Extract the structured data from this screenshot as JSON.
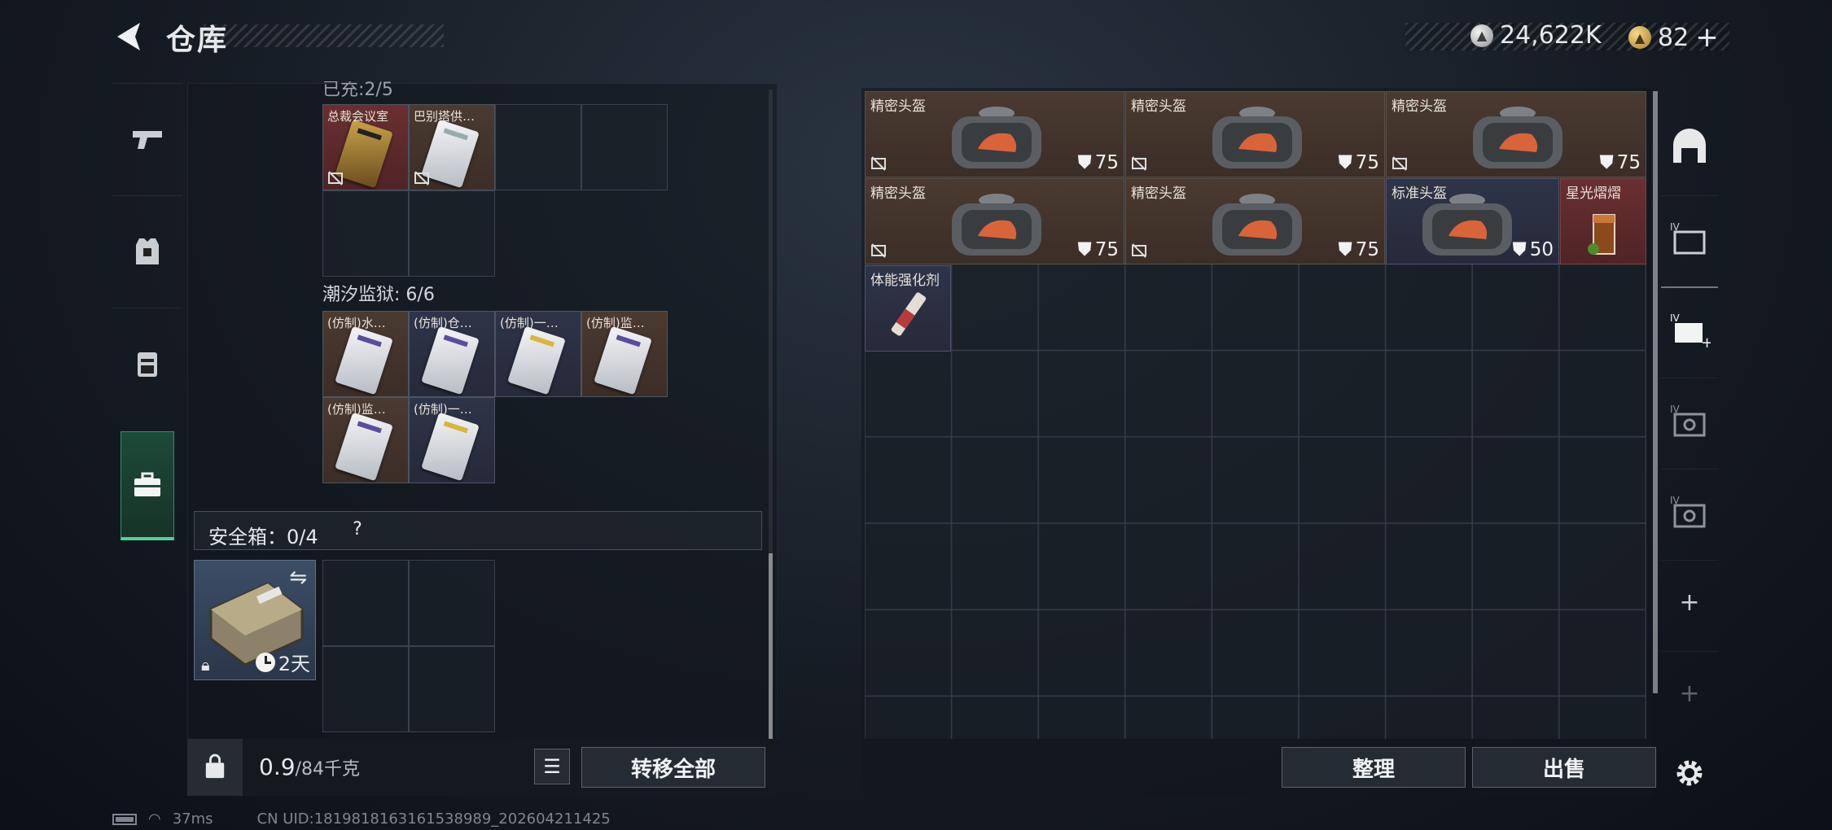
{
  "header": {
    "title": "仓库",
    "currency_silver": "24,622K",
    "currency_gold": "82",
    "currency_gold_plus": "+"
  },
  "left_panel": {
    "top_section_label_cut": "已充:2/5",
    "prison_section_label": "潮汐监狱: 6/6",
    "top_items": [
      {
        "name": "总裁会议室",
        "card": "gold",
        "bg": "red"
      },
      {
        "name": "巴别塔供…",
        "card": "white",
        "bg": "brown"
      }
    ],
    "prison_items": [
      {
        "name": "(仿制)水…",
        "card": "purple",
        "bg": "brown"
      },
      {
        "name": "(仿制)仓…",
        "card": "purple",
        "bg": "navy"
      },
      {
        "name": "(仿制)一…",
        "card": "gold-stripe",
        "bg": "navy"
      },
      {
        "name": "(仿制)监…",
        "card": "purple",
        "bg": "brown"
      },
      {
        "name": "(仿制)监…",
        "card": "purple",
        "bg": "brown"
      },
      {
        "name": "(仿制)一…",
        "card": "gold-stripe",
        "bg": "navy"
      }
    ],
    "safe_box": {
      "label": "安全箱：0/4",
      "help": "?",
      "timer": "2天"
    },
    "weight": {
      "current": "0.9",
      "capacity": "/84千克"
    },
    "transfer_all_label": "转移全部"
  },
  "right_panel": {
    "items": [
      {
        "name": "精密头盔",
        "armor": "75",
        "bg": "brown"
      },
      {
        "name": "精密头盔",
        "armor": "75",
        "bg": "brown"
      },
      {
        "name": "精密头盔",
        "armor": "75",
        "bg": "brown"
      },
      {
        "name": "精密头盔",
        "armor": "75",
        "bg": "brown"
      },
      {
        "name": "精密头盔",
        "armor": "75",
        "bg": "brown"
      },
      {
        "name": "标准头盔",
        "armor": "50",
        "bg": "navy"
      }
    ],
    "drink": {
      "name": "星光熠熠"
    },
    "stim": {
      "name": "体能强化剂"
    },
    "organize_label": "整理",
    "sell_label": "出售"
  },
  "status_bar": {
    "ping": "37ms",
    "uid": "CN UID:1819818163161538989_202604211425"
  },
  "colors": {
    "accent_green": "#4fd39a",
    "item_brown": "#4a3a30",
    "item_navy": "#2e3448",
    "item_red": "#6a2f30"
  }
}
